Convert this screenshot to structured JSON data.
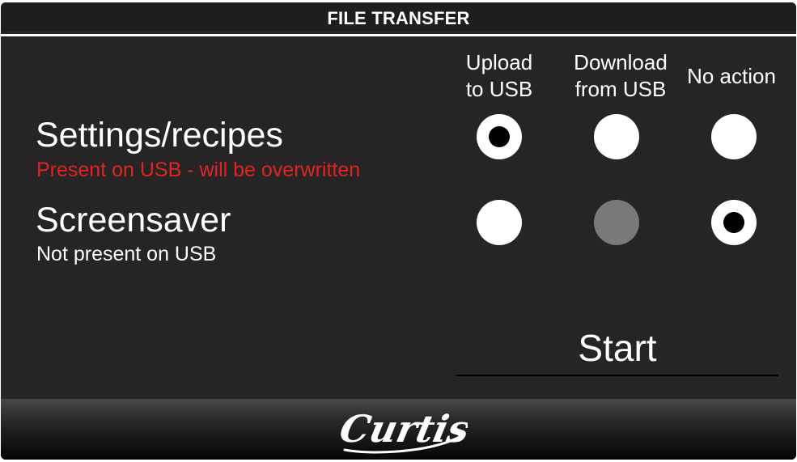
{
  "header": {
    "title": "FILE TRANSFER"
  },
  "columns": [
    {
      "line1": "Upload",
      "line2": "to USB"
    },
    {
      "line1": "Download",
      "line2": "from USB"
    },
    {
      "line1": "No action",
      "line2": ""
    }
  ],
  "rows": [
    {
      "title": "Settings/recipes",
      "status": "Present on USB - will be overwritten",
      "status_color": "#e02424",
      "options": [
        {
          "column": "Upload to USB",
          "selected": true,
          "enabled": true
        },
        {
          "column": "Download from USB",
          "selected": false,
          "enabled": true
        },
        {
          "column": "No action",
          "selected": false,
          "enabled": true
        }
      ]
    },
    {
      "title": "Screensaver",
      "status": "Not present on USB",
      "status_color": "#ffffff",
      "options": [
        {
          "column": "Upload to USB",
          "selected": false,
          "enabled": true
        },
        {
          "column": "Download from USB",
          "selected": false,
          "enabled": false
        },
        {
          "column": "No action",
          "selected": true,
          "enabled": true
        }
      ]
    }
  ],
  "actions": {
    "start_label": "Start"
  },
  "footer": {
    "logo_text": "Curtis",
    "logo_icon": "curtis-logo"
  },
  "colors": {
    "background": "#262424",
    "text": "#ffffff",
    "warning": "#e02424",
    "radio": "#ffffff",
    "radio_disabled": "#7a7878",
    "radio_dot": "#000000"
  }
}
